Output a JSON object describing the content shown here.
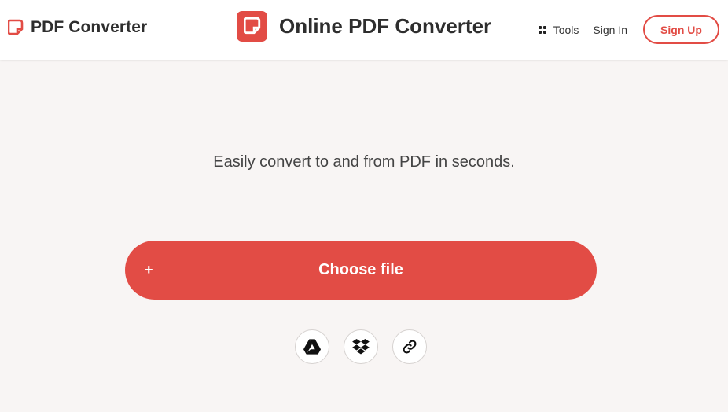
{
  "header": {
    "brand_name": "PDF Converter",
    "center_title": "Online PDF Converter",
    "nav": {
      "tools_label": "Tools",
      "signin_label": "Sign In",
      "signup_label": "Sign Up"
    }
  },
  "main": {
    "tagline": "Easily convert to and from PDF in seconds.",
    "choose_file": {
      "plus": "+",
      "label": "Choose file"
    },
    "sources": [
      {
        "icon": "google-drive-icon"
      },
      {
        "icon": "dropbox-icon"
      },
      {
        "icon": "link-icon"
      }
    ]
  },
  "colors": {
    "accent": "#e24c45",
    "background": "#f8f5f4",
    "header_bg": "#ffffff",
    "text": "#333333"
  }
}
